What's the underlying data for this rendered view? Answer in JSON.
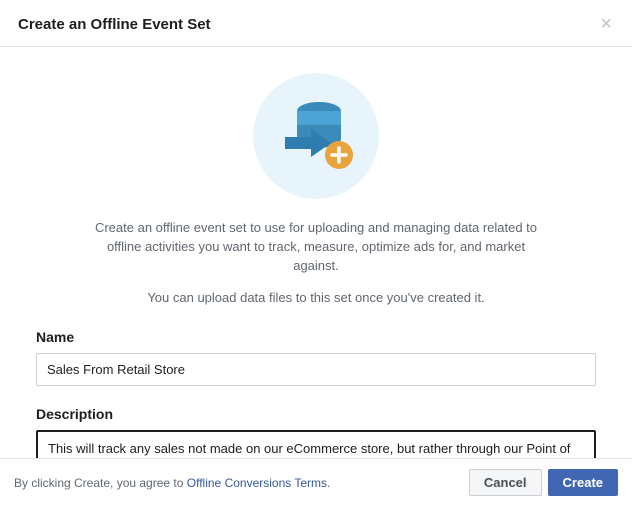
{
  "header": {
    "title": "Create an Offline Event Set"
  },
  "body": {
    "description_main": "Create an offline event set to use for uploading and managing data related to offline activities you want to track, measure, optimize ads for, and market against.",
    "description_sub": "You can upload data files to this set once you've created it.",
    "name_label": "Name",
    "name_value": "Sales From Retail Store",
    "description_label": "Description",
    "description_value": "This will track any sales not made on our eCommerce store, but rather through our Point of Sale in the store."
  },
  "footer": {
    "terms_prefix": "By clicking Create, you agree to ",
    "terms_link": "Offline Conversions Terms",
    "terms_suffix": ".",
    "cancel_label": "Cancel",
    "create_label": "Create"
  }
}
